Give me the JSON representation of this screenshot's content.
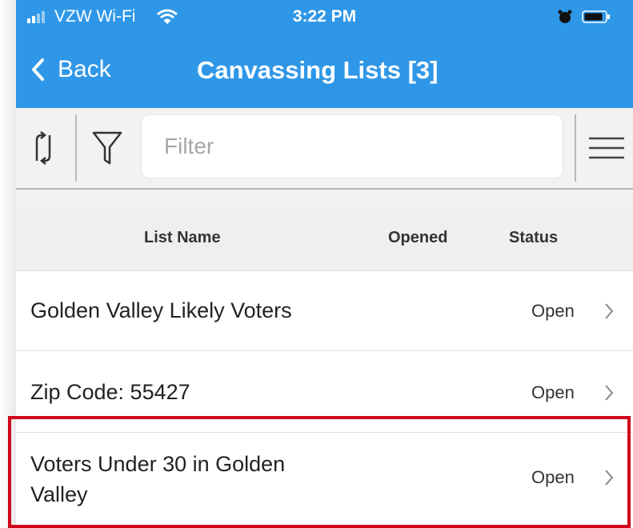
{
  "status_bar": {
    "carrier": "VZW Wi-Fi",
    "time": "3:22 PM",
    "icons": [
      "signal-icon",
      "wifi-icon",
      "alarm-icon",
      "battery-icon"
    ]
  },
  "nav": {
    "back_label": "Back",
    "title": "Canvassing Lists [3]"
  },
  "toolbar": {
    "filter_placeholder": "Filter",
    "icons": [
      "sync-icon",
      "funnel-icon",
      "menu-icon"
    ]
  },
  "table": {
    "columns": [
      "List Name",
      "Opened",
      "Status"
    ],
    "rows": [
      {
        "name": "Golden Valley Likely Voters",
        "opened": "",
        "status": "Open"
      },
      {
        "name": "Zip Code: 55427",
        "opened": "",
        "status": "Open"
      },
      {
        "name": "Voters Under 30 in Golden Valley",
        "opened": "",
        "status": "Open"
      }
    ]
  },
  "colors": {
    "header_blue": "#2f97e8",
    "highlight_red": "#d0021b",
    "toolbar_gray": "#f2f2f2"
  }
}
